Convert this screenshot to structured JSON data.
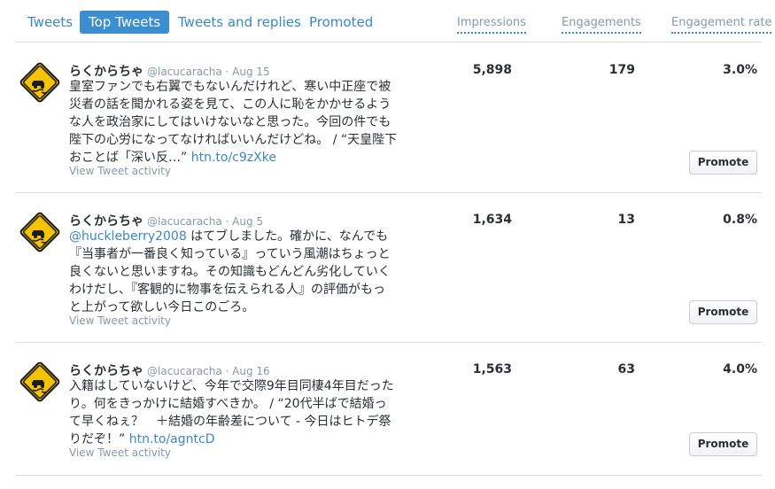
{
  "tabs": [
    {
      "label": "Tweets"
    },
    {
      "label": "Top Tweets"
    },
    {
      "label": "Tweets and replies"
    },
    {
      "label": "Promoted"
    }
  ],
  "columns": {
    "impressions": "Impressions",
    "engagements": "Engagements",
    "rate": "Engagement rate"
  },
  "colors": {
    "accent": "#3b88c3",
    "active_tab": "#3b8fd1",
    "muted": "#8899a6",
    "avatar_sign": "#f5c400"
  },
  "avatar_icon": "caution-road-sign-icon",
  "activity_label": "View Tweet activity",
  "promote_label": "Promote",
  "tweets": [
    {
      "name": "らくからちゃ",
      "handle": "@lacucaracha · Aug 15",
      "lines": [
        "皇室ファンでも右翼でもないんだけれど、寒い中正座で被",
        "災者の話を聞かれる姿を見て、この人に恥をかかせるよう",
        "な人を政治家にしてはいけないなと思った。今回の件でも",
        "陛下の心労になってなければいいんだけどね。 / “天皇陛下",
        "おことば「深い反…”"
      ],
      "link": "htn.to/c9zXke",
      "impressions": "5,898",
      "engagements": "179",
      "rate": "3.0%"
    },
    {
      "name": "らくからちゃ",
      "handle": "@lacucaracha · Aug 5",
      "mention": "@huckleberry2008",
      "lines": [
        " はてブしました。確かに、なんでも",
        "『当事者が一番良く知っている』っていう風潮はちょっと",
        "良くないと思いますね。その知識もどんどん劣化していく",
        "わけだし、『客観的に物事を伝えられる人』の評価がもっ",
        "と上がって欲しい今日このごろ。"
      ],
      "impressions": "1,634",
      "engagements": "13",
      "rate": "0.8%"
    },
    {
      "name": "らくからちゃ",
      "handle": "@lacucaracha · Aug 16",
      "lines": [
        "入籍はしていないけど、今年で交際9年目同棲4年目だった",
        "り。何をきっかけに結婚すべきか。 / “20代半ばで結婚っ",
        "て早くねぇ？　＋結婚の年齢差について - 今日はヒトデ祭",
        "りだぞ！”"
      ],
      "link": "htn.to/agntcD",
      "impressions": "1,563",
      "engagements": "63",
      "rate": "4.0%"
    }
  ]
}
